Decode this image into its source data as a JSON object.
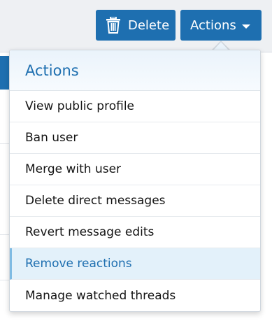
{
  "toolbar": {
    "delete_label": "Delete",
    "actions_label": "Actions",
    "delete_icon": "trash-icon",
    "actions_icon": "caret-down-icon"
  },
  "menu": {
    "title": "Actions",
    "items": [
      {
        "label": "View public profile",
        "active": false
      },
      {
        "label": "Ban user",
        "active": false
      },
      {
        "label": "Merge with user",
        "active": false
      },
      {
        "label": "Delete direct messages",
        "active": false
      },
      {
        "label": "Revert message edits",
        "active": false
      },
      {
        "label": "Remove reactions",
        "active": true
      },
      {
        "label": "Manage watched threads",
        "active": false
      }
    ]
  },
  "colors": {
    "accent": "#1e6fb0",
    "menu_header_bg": "#eaf3fb",
    "active_item_bg": "#e3f1fa",
    "text": "#141414"
  }
}
